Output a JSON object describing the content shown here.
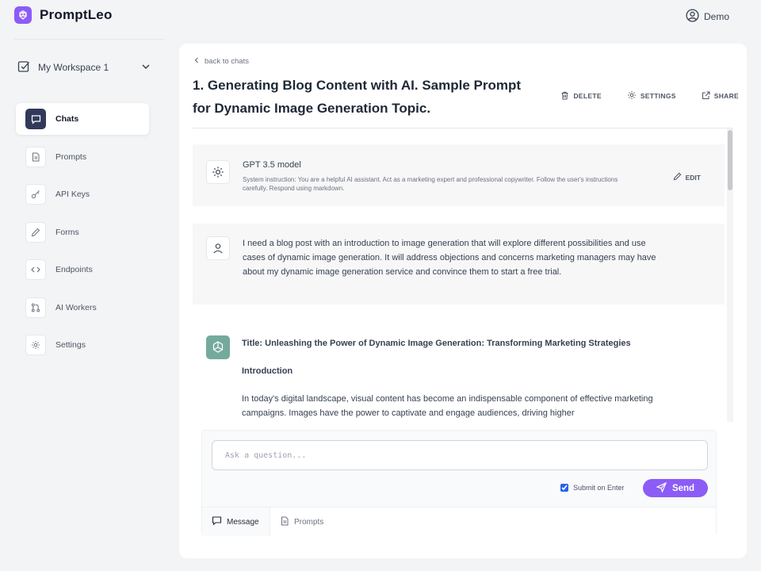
{
  "app": {
    "name": "PromptLeo",
    "brand_color": "#8b5cf6"
  },
  "user": {
    "name": "Demo",
    "icon": "user-circle-icon"
  },
  "workspace": {
    "label": "My Workspace 1",
    "icon": "checkbox-icon"
  },
  "sidebar": {
    "items": [
      {
        "label": "Chats",
        "icon": "chat-icon",
        "active": true
      },
      {
        "label": "Prompts",
        "icon": "document-icon"
      },
      {
        "label": "API Keys",
        "icon": "key-icon"
      },
      {
        "label": "Forms",
        "icon": "pencil-icon"
      },
      {
        "label": "Endpoints",
        "icon": "code-icon"
      },
      {
        "label": "AI Workers",
        "icon": "git-pull-icon"
      },
      {
        "label": "Settings",
        "icon": "gear-icon"
      }
    ]
  },
  "chat": {
    "back_label": "back to chats",
    "title": "1. Generating Blog Content with AI. Sample Prompt for Dynamic Image Generation Topic.",
    "actions": {
      "delete": "DELETE",
      "settings": "SETTINGS",
      "share": "SHARE"
    },
    "system": {
      "model": "GPT 3.5 model",
      "instruction": "System instruction: You are a helpful AI assistant. Act as a marketing expert and professional copywriter. Follow the user's instructions carefully. Respond using markdown.",
      "edit_label": "EDIT"
    },
    "user_message": "I need a blog post with an introduction to image generation that will explore different possibilities and use cases of dynamic image generation. It will address objections and concerns marketing managers may have about my dynamic image generation service and convince them to start a free trial.",
    "assistant_message": {
      "title": "Title: Unleashing the Power of Dynamic Image Generation: Transforming Marketing Strategies",
      "heading": "Introduction",
      "paragraph": "In today's digital landscape, visual content has become an indispensable component of effective marketing campaigns. Images have the power to captivate and engage audiences, driving higher"
    }
  },
  "composer": {
    "placeholder": "Ask a question...",
    "submit_on_enter_label": "Submit on Enter",
    "submit_on_enter_checked": true,
    "send_label": "Send",
    "tabs": [
      {
        "label": "Message",
        "icon": "chat-icon"
      },
      {
        "label": "Prompts",
        "icon": "document-icon"
      }
    ]
  }
}
